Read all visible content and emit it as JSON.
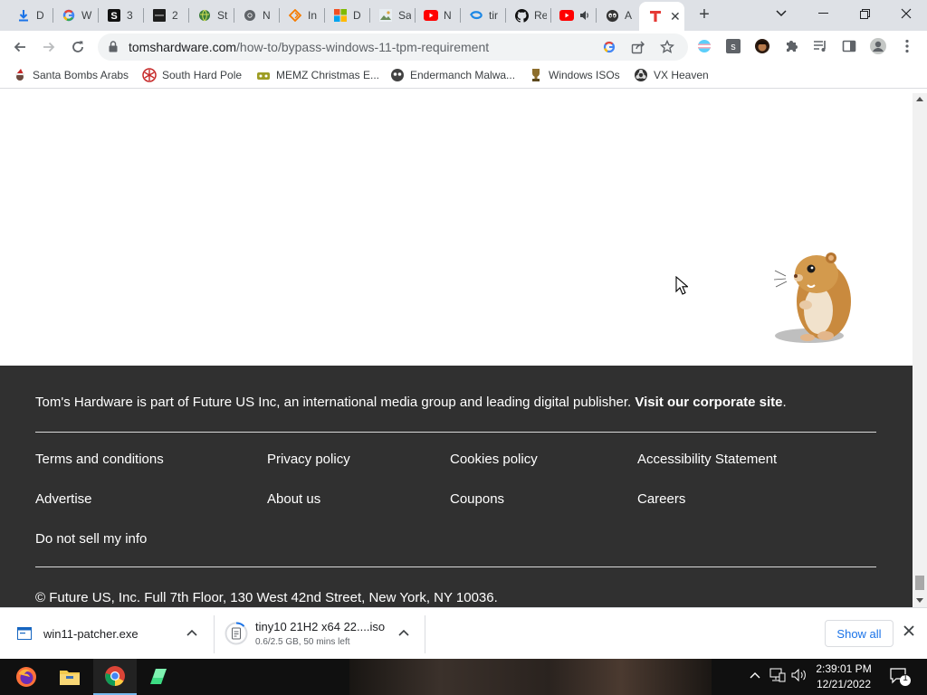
{
  "browser": {
    "tabs": [
      {
        "title": "Downloads",
        "short": "D",
        "icon": "download-icon"
      },
      {
        "title": "Google",
        "short": "W",
        "icon": "google-icon"
      },
      {
        "title": "S",
        "short": "3",
        "icon": "s-icon"
      },
      {
        "title": "2",
        "short": "2",
        "icon": "dark-site-icon"
      },
      {
        "title": "St",
        "short": "St",
        "icon": "globe-icon"
      },
      {
        "title": "N",
        "short": "N",
        "icon": "chrome-icon"
      },
      {
        "title": "In",
        "short": "In",
        "icon": "diamond-icon"
      },
      {
        "title": "D",
        "short": "D",
        "icon": "microsoft-icon"
      },
      {
        "title": "Sa",
        "short": "Sa",
        "icon": "image-icon"
      },
      {
        "title": "N",
        "short": "N",
        "icon": "youtube-icon"
      },
      {
        "title": "tir",
        "short": "tir",
        "icon": "blue-swirl-icon"
      },
      {
        "title": "R",
        "short": "Re",
        "icon": "github-icon"
      },
      {
        "title": "",
        "short": "",
        "icon": "youtube-audio-icon"
      },
      {
        "title": "A",
        "short": "A",
        "icon": "alien-icon"
      },
      {
        "title": "",
        "short": "",
        "icon": "toms-hardware-icon",
        "active": true
      }
    ],
    "url": {
      "host": "tomshardware.com",
      "path": "/how-to/bypass-windows-11-tpm-requirement"
    },
    "bookmarks": [
      {
        "label": "Santa Bombs Arabs",
        "icon": "santa-icon"
      },
      {
        "label": "South Hard Pole",
        "icon": "snowflake-icon"
      },
      {
        "label": "MEMZ Christmas E...",
        "icon": "memz-icon"
      },
      {
        "label": "Endermanch Malwa...",
        "icon": "ender-icon"
      },
      {
        "label": "Windows ISOs",
        "icon": "trophy-icon"
      },
      {
        "label": "VX Heaven",
        "icon": "biohazard-icon"
      }
    ]
  },
  "footer": {
    "intro_text": "Tom's Hardware is part of Future US Inc, an international media group and leading digital publisher.",
    "intro_link": "Visit our corporate site",
    "intro_end": ".",
    "links": {
      "terms": "Terms and conditions",
      "privacy": "Privacy policy",
      "cookies": "Cookies policy",
      "accessibility": "Accessibility Statement",
      "advertise": "Advertise",
      "about": "About us",
      "coupons": "Coupons",
      "careers": "Careers",
      "donotsell": "Do not sell my info"
    },
    "copyright": "© Future US, Inc. Full 7th Floor, 130 West 42nd Street, New York, NY 10036."
  },
  "downloads": {
    "items": [
      {
        "name": "win11-patcher.exe",
        "status": ""
      },
      {
        "name": "tiny10 21H2 x64 22....iso",
        "status": "0.6/2.5 GB, 50 mins left"
      }
    ],
    "show_all": "Show all"
  },
  "taskbar": {
    "time": "2:39:01 PM",
    "date": "12/21/2022",
    "notification_count": "1"
  }
}
